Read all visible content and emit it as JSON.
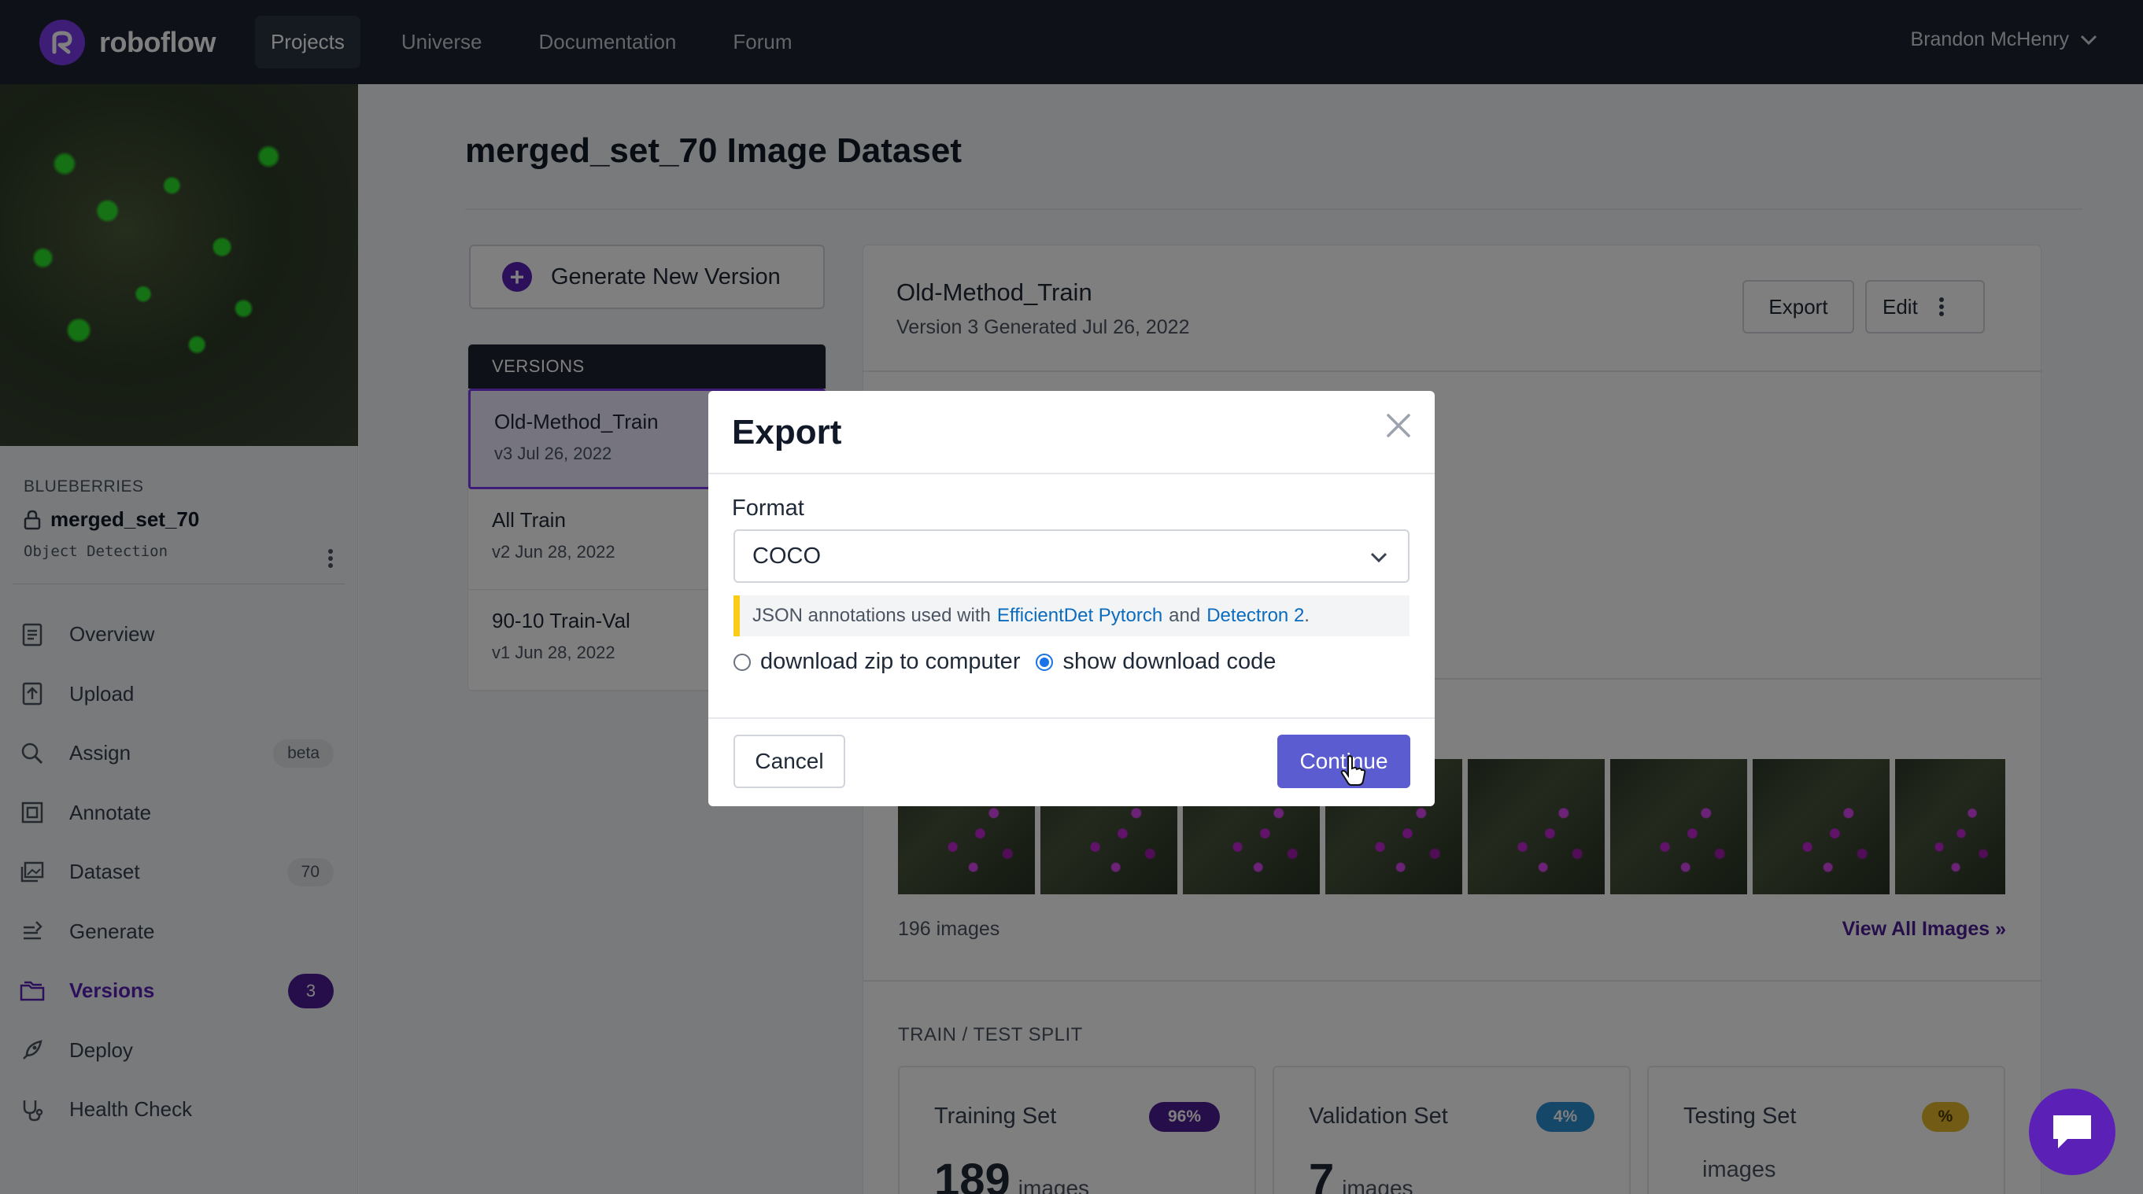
{
  "nav": {
    "logo_text": "roboflow",
    "links": [
      "Projects",
      "Universe",
      "Documentation",
      "Forum"
    ],
    "active": "Projects",
    "user_name": "Brandon McHenry"
  },
  "sidebar": {
    "workspace": "BLUEBERRIES",
    "project_name": "merged_set_70",
    "project_type": "Object Detection",
    "items": [
      {
        "label": "Overview",
        "icon": "document-icon"
      },
      {
        "label": "Upload",
        "icon": "upload-icon"
      },
      {
        "label": "Assign",
        "icon": "search-icon",
        "badge": "beta"
      },
      {
        "label": "Annotate",
        "icon": "annotate-icon"
      },
      {
        "label": "Dataset",
        "icon": "images-icon",
        "badge": "70"
      },
      {
        "label": "Generate",
        "icon": "generate-icon"
      },
      {
        "label": "Versions",
        "icon": "versions-icon",
        "badge": "3",
        "active": true
      },
      {
        "label": "Deploy",
        "icon": "rocket-icon"
      },
      {
        "label": "Health Check",
        "icon": "stethoscope-icon"
      }
    ]
  },
  "main": {
    "page_title": "merged_set_70 Image Dataset",
    "generate_button": "Generate New Version",
    "versions_header": "VERSIONS",
    "versions": [
      {
        "name": "Old-Method_Train",
        "sub": "v3 Jul 26, 2022"
      },
      {
        "name": "All Train",
        "sub": "v2 Jun 28, 2022"
      },
      {
        "name": "90-10 Train-Val",
        "sub": "v1 Jun 28, 2022"
      }
    ],
    "detail": {
      "name": "Old-Method_Train",
      "sub": "Version 3 Generated Jul 26, 2022",
      "export_label": "Export",
      "edit_label": "Edit",
      "images_count": "196 images",
      "view_all": "View All Images »",
      "split_title": "TRAIN / TEST SPLIT",
      "splits": [
        {
          "name": "Training Set",
          "pct": "96%",
          "count": "189",
          "unit": "images",
          "color": "#4c1d95",
          "text_color": "#ffffff"
        },
        {
          "name": "Validation Set",
          "pct": "4%",
          "count": "7",
          "unit": "images",
          "color": "#2b8fd1",
          "text_color": "#ffffff"
        },
        {
          "name": "Testing Set",
          "pct": "%",
          "count": "",
          "unit": "images",
          "color": "#e5b92a",
          "text_color": "#4a3a00"
        }
      ]
    }
  },
  "modal": {
    "title": "Export",
    "format_label": "Format",
    "format_value": "COCO",
    "note_prefix": "JSON annotations used with",
    "note_link1": "EfficientDet Pytorch",
    "note_and": "and",
    "note_link2": "Detectron 2",
    "note_suffix": ".",
    "radio_zip": "download zip to computer",
    "radio_code": "show download code",
    "selected_option": "show download code",
    "cancel_label": "Cancel",
    "continue_label": "Continue"
  },
  "colors": {
    "brand_purple": "#5b21b6",
    "nav_bg": "#1c2330",
    "continue_button": "#5b5ccf",
    "note_accent": "#facc15",
    "link_blue": "#0b6bbd"
  }
}
